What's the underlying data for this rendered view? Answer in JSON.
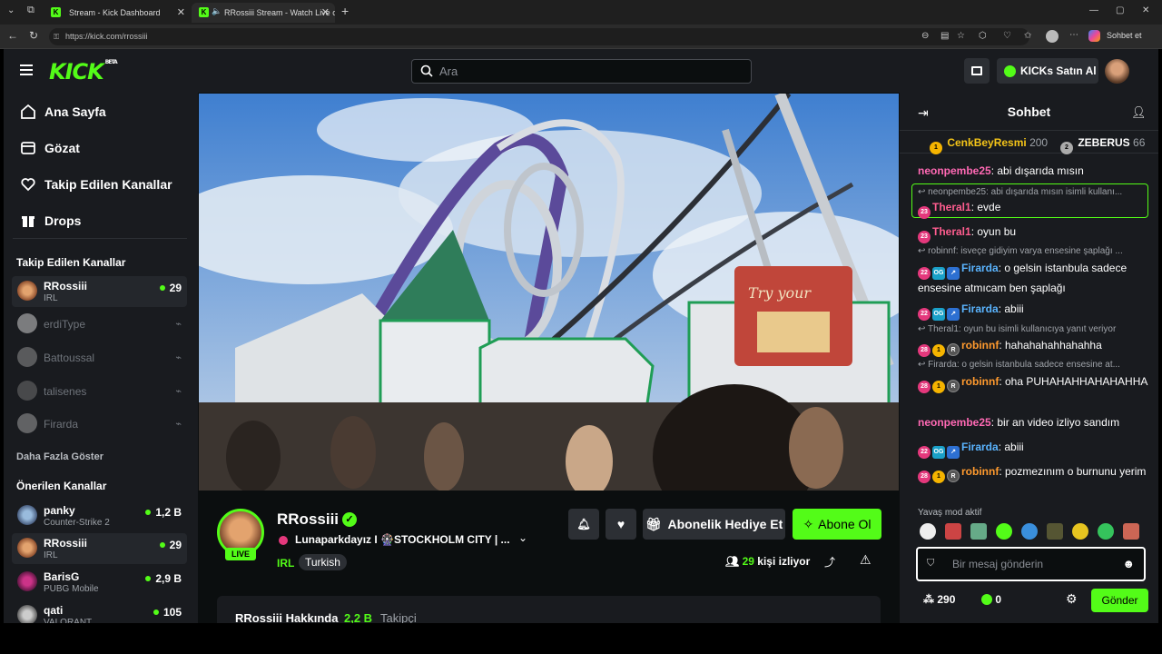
{
  "browser": {
    "tabs": [
      {
        "title": "Stream - Kick Dashboard"
      },
      {
        "title": "RRossiii Stream - Watch Live o"
      }
    ],
    "url": "https://kick.com/rrossiii",
    "chat_button": "Sohbet et"
  },
  "topbar": {
    "logo": "KICK",
    "logo_badge": "BETA",
    "search_placeholder": "Ara",
    "kicks_button": "KICKs Satın Al"
  },
  "sidebar": {
    "nav": [
      {
        "label": "Ana Sayfa",
        "icon": "home-icon"
      },
      {
        "label": "Gözat",
        "icon": "browse-icon"
      },
      {
        "label": "Takip Edilen Kanallar",
        "icon": "heart-icon"
      },
      {
        "label": "Drops",
        "icon": "drops-icon"
      }
    ],
    "followed_title": "Takip Edilen Kanallar",
    "followed": [
      {
        "name": "RRossiii",
        "category": "IRL",
        "viewers": "29",
        "live": true
      },
      {
        "name": "erdiType",
        "live": false
      },
      {
        "name": "Battoussal",
        "live": false
      },
      {
        "name": "talisenes",
        "live": false
      },
      {
        "name": "Firarda",
        "live": false
      }
    ],
    "show_more": "Daha Fazla Göster",
    "recommended_title": "Önerilen Kanallar",
    "recommended": [
      {
        "name": "panky",
        "category": "Counter-Strike 2",
        "viewers": "1,2 B"
      },
      {
        "name": "RRossiii",
        "category": "IRL",
        "viewers": "29"
      },
      {
        "name": "BarisG",
        "category": "PUBG Mobile",
        "viewers": "2,9 B"
      },
      {
        "name": "qati",
        "category": "VALORANT",
        "viewers": "105"
      }
    ]
  },
  "stream": {
    "channel": "RRossiii",
    "live_badge": "LIVE",
    "title": "Lunaparkdayız I 🎡STOCKHOLM CITY | ...",
    "category": "IRL",
    "tag": "Turkish",
    "viewers": "29",
    "viewers_label": "kişi izliyor",
    "gift_button": "Abonelik Hediye Et",
    "subscribe_button": "Abone Ol",
    "about": "RRossiii Hakkında",
    "followers": "2,2 B",
    "followers_label": "Takipçi"
  },
  "chat": {
    "title": "Sohbet",
    "top": [
      {
        "rank": "1",
        "name": "CenkBeyResmi",
        "score": "200"
      },
      {
        "rank": "2",
        "name": "ZEBERUS",
        "score": "66"
      }
    ],
    "messages": [
      {
        "user": "neonpembe25",
        "text": "abi dışarıda mısın",
        "color": "#ff69b4"
      },
      {
        "reply": "neonpembe25: abi dışarıda mısın isimli kullanı...",
        "user": "Theral1",
        "text": "evde",
        "color": "#ff5d8f"
      },
      {
        "user": "Theral1",
        "text": "oyun bu",
        "color": "#ff5d8f"
      },
      {
        "reply": "robinnf: isveçe gidiyim varya ensesine şaplağı ...",
        "user": "Firarda",
        "text": "o gelsin istanbula sadece ensesine atmıcam ben şaplağı",
        "color": "#5ab4ff"
      },
      {
        "user": "Firarda",
        "text": "abiii",
        "color": "#5ab4ff"
      },
      {
        "reply": "Theral1: oyun bu isimli kullanıcıya yanıt veriyor",
        "user": "robinnf",
        "text": "hahahahahhahahha",
        "color": "#ff9a2e"
      },
      {
        "reply": "Firarda: o gelsin istanbula sadece ensesine at...",
        "user": "robinnf",
        "text": "oha PUHAHAHHAHAHAHHA",
        "color": "#ff9a2e"
      },
      {
        "user": "neonpembe25",
        "text": "bir an video izliyo sandım",
        "color": "#ff69b4"
      },
      {
        "user": "Firarda",
        "text": "abiii",
        "color": "#5ab4ff"
      },
      {
        "user": "robinnf",
        "text": "pozmezınım o burnunu yerim",
        "color": "#ff9a2e"
      }
    ],
    "slow_mode": "Yavaş mod aktif",
    "input_placeholder": "Bir mesaj gönderin",
    "points": "290",
    "kicks": "0",
    "send_button": "Gönder"
  },
  "colors": {
    "accent": "#53fc18",
    "bg": "#0b0e0f",
    "panel": "#191b1f"
  }
}
